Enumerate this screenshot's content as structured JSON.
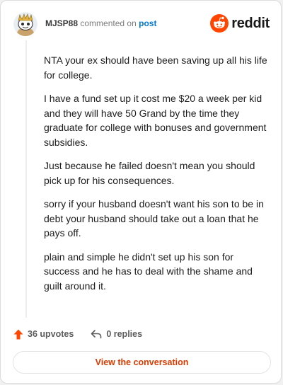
{
  "header": {
    "username": "MJSP88",
    "commented_on": "commented on",
    "post_link": "post",
    "brand_name": "reddit"
  },
  "comment": {
    "paragraphs": [
      "NTA your ex should have been saving up all his life for college.",
      "I have a fund set up it cost me $20 a week per kid and they will have 50 Grand by the time they graduate for college with bonuses and government subsidies.",
      "Just because he failed doesn't mean you should pick up for his consequences.",
      "sorry if your husband doesn't want his son to be in debt your husband should take out a loan that he pays off.",
      "plain and simple he didn't set up his son for success and he has to deal with the shame and guilt around it."
    ]
  },
  "actions": {
    "upvotes_label": "36 upvotes",
    "replies_label": "0 replies",
    "upvote_icon": "upvote-arrow-icon",
    "reply_icon": "reply-arrow-icon"
  },
  "cta": {
    "label": "View the conversation"
  },
  "colors": {
    "brand": "#ff4500",
    "link": "#0079d3",
    "cta_text": "#d93a00"
  }
}
